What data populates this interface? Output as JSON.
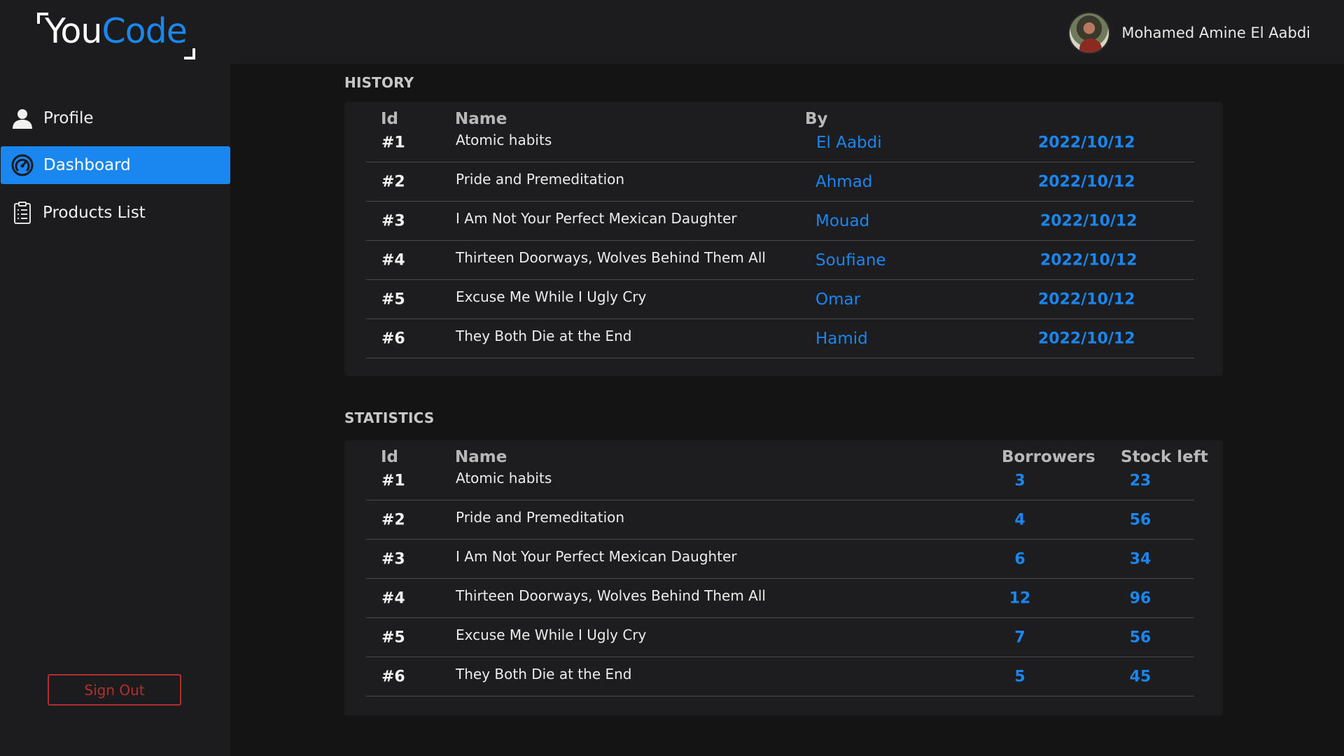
{
  "app": {
    "logo_you": "You",
    "logo_code": "Code"
  },
  "user": {
    "name": "Mohamed Amine El Aabdi"
  },
  "sidebar": {
    "items": [
      {
        "label": "Profile",
        "icon": "user-icon",
        "active": false
      },
      {
        "label": "Dashboard",
        "icon": "speedometer-icon",
        "active": true
      },
      {
        "label": "Products List",
        "icon": "clipboard-list-icon",
        "active": false
      }
    ],
    "signout_label": "Sign Out"
  },
  "history": {
    "title": "HISTORY",
    "columns": [
      "Id",
      "Name",
      "By"
    ],
    "rows": [
      {
        "id": "#1",
        "name": "Atomic habits",
        "by": "El Aabdi",
        "date": "2022/10/12"
      },
      {
        "id": "#2",
        "name": "Pride and Premeditation",
        "by": "Ahmad",
        "date": "2022/10/12"
      },
      {
        "id": "#3",
        "name": "I Am Not Your Perfect Mexican Daughter",
        "by": "Mouad",
        "date": "2022/10/12"
      },
      {
        "id": "#4",
        "name": "Thirteen Doorways, Wolves Behind Them All",
        "by": "Soufiane",
        "date": "2022/10/12"
      },
      {
        "id": "#5",
        "name": "Excuse Me While I Ugly Cry",
        "by": "Omar",
        "date": "2022/10/12"
      },
      {
        "id": "#6",
        "name": "They Both Die at the End",
        "by": "Hamid",
        "date": "2022/10/12"
      }
    ]
  },
  "statistics": {
    "title": "STATISTICS",
    "columns": [
      "Id",
      "Name",
      "Borrowers",
      "Stock left"
    ],
    "rows": [
      {
        "id": "#1",
        "name": "Atomic habits",
        "borrowers": "3",
        "stock": "23"
      },
      {
        "id": "#2",
        "name": "Pride and Premeditation",
        "borrowers": "4",
        "stock": "56"
      },
      {
        "id": "#3",
        "name": "I Am Not Your Perfect Mexican Daughter",
        "borrowers": "6",
        "stock": "34"
      },
      {
        "id": "#4",
        "name": "Thirteen Doorways, Wolves Behind Them All",
        "borrowers": "12",
        "stock": "96"
      },
      {
        "id": "#5",
        "name": "Excuse Me While I Ugly Cry",
        "borrowers": "7",
        "stock": "56"
      },
      {
        "id": "#6",
        "name": "They Both Die at the End",
        "borrowers": "5",
        "stock": "45"
      }
    ]
  },
  "colors": {
    "accent": "#1a86f0",
    "danger": "#b03030",
    "background": "#141415",
    "surface": "#1c1c1e"
  }
}
